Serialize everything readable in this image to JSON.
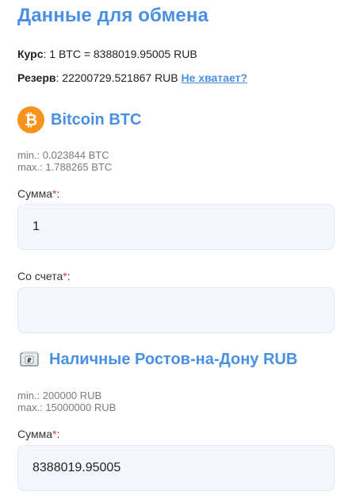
{
  "page": {
    "title": "Данные для обмена"
  },
  "rate": {
    "label": "Курс",
    "value": ": 1 BTC = 8388019.95005 RUB"
  },
  "reserve": {
    "label": "Резерв",
    "value": ": 22200729.521867 RUB ",
    "link": "Не хватает?"
  },
  "give": {
    "currency_name": "Bitcoin BTC",
    "icon": "bitcoin-icon",
    "icon_color": "#f7931a",
    "min": "min.: 0.023844 BTC",
    "max": "max.: 1.788265 BTC",
    "sum_label": "Сумма",
    "sum_value": "1",
    "account_label": "Со счета",
    "account_value": ""
  },
  "get": {
    "currency_name": "Наличные Ростов-на-Дону RUB",
    "icon": "cash-icon",
    "min": "min.: 200000 RUB",
    "max": "max.: 15000000 RUB",
    "sum_label": "Сумма",
    "sum_value": "8388019.95005"
  },
  "required_mark": "*",
  "colors": {
    "accent": "#4a90e2",
    "required": "#e53935",
    "field_bg": "#f3f7fd"
  }
}
